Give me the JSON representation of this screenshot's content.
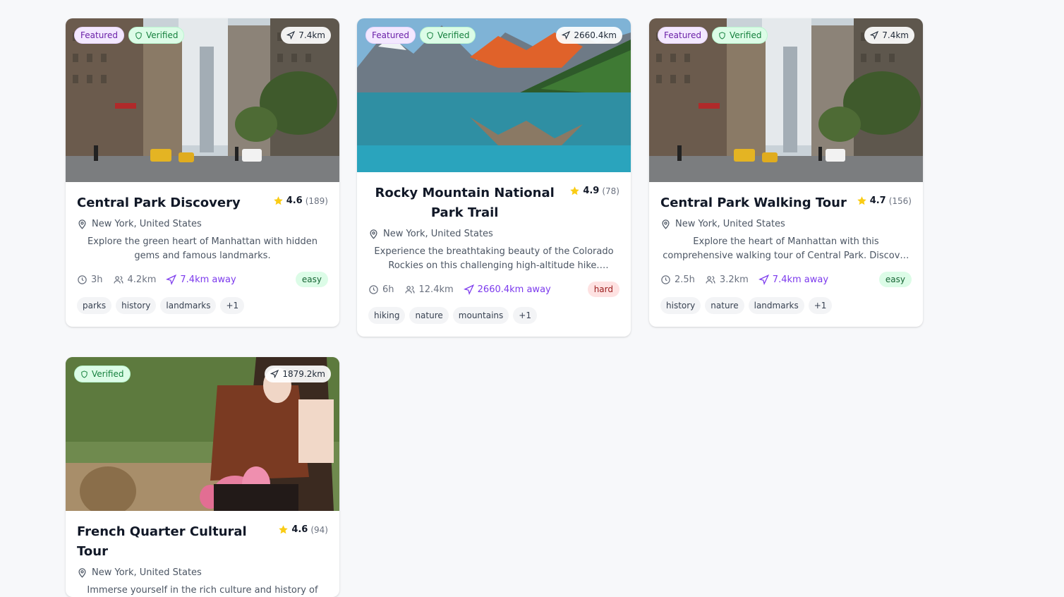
{
  "cards": [
    {
      "featured_label": "Featured",
      "verified_label": "Verified",
      "distance": "7.4km",
      "title": "Central Park Discovery",
      "rating": "4.6",
      "reviews": "(189)",
      "location": "New York, United States",
      "description": "Explore the green heart of Manhattan with hidden gems and famous landmarks.",
      "duration": "3h",
      "length": "4.2km",
      "away": "7.4km away",
      "difficulty": "easy",
      "tags": [
        "parks",
        "history",
        "landmarks",
        "+1"
      ]
    },
    {
      "featured_label": "Featured",
      "verified_label": "Verified",
      "distance": "2660.4km",
      "title": "Rocky Mountain National Park Trail",
      "rating": "4.9",
      "reviews": "(78)",
      "location": "New York, United States",
      "description": "Experience the breathtaking beauty of the Colorado Rockies on this challenging high-altitude hike. Wildlife...",
      "duration": "6h",
      "length": "12.4km",
      "away": "2660.4km away",
      "difficulty": "hard",
      "tags": [
        "hiking",
        "nature",
        "mountains",
        "+1"
      ]
    },
    {
      "featured_label": "Featured",
      "verified_label": "Verified",
      "distance": "7.4km",
      "title": "Central Park Walking Tour",
      "rating": "4.7",
      "reviews": "(156)",
      "location": "New York, United States",
      "description": "Explore the heart of Manhattan with this comprehensive walking tour of Central Park. Discover hidden gems,...",
      "duration": "2.5h",
      "length": "3.2km",
      "away": "7.4km away",
      "difficulty": "easy",
      "tags": [
        "history",
        "nature",
        "landmarks",
        "+1"
      ]
    },
    {
      "verified_label": "Verified",
      "distance": "1879.2km",
      "title": "French Quarter Cultural Tour",
      "rating": "4.6",
      "reviews": "(94)",
      "location": "New York, United States",
      "description": "Immerse yourself in the rich culture and history of New Orleans' French Quarter. Explore the vibrant architecture..."
    }
  ],
  "colors": {
    "accent": "#7c3aed",
    "star": "#facc15",
    "featured": "#6b21a8",
    "verified": "#15803d"
  }
}
